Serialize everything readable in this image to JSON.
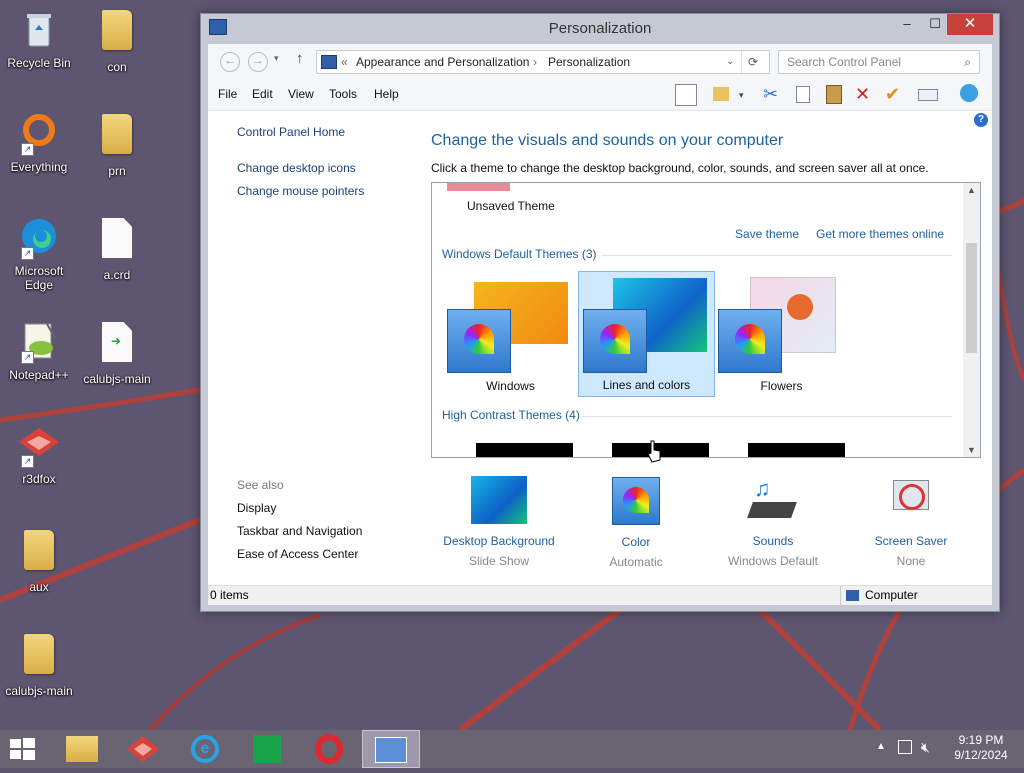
{
  "desktop": {
    "icons": [
      {
        "label": "Recycle Bin",
        "icon": "recycle-bin-icon"
      },
      {
        "label": "con",
        "icon": "folder-icon"
      },
      {
        "label": "Everything",
        "icon": "everything-icon"
      },
      {
        "label": "prn",
        "icon": "folder-icon"
      },
      {
        "label": "Microsoft Edge",
        "icon": "edge-icon"
      },
      {
        "label": "a.crd",
        "icon": "file-icon"
      },
      {
        "label": "Notepad++",
        "icon": "notepadpp-icon"
      },
      {
        "label": "calubjs-main",
        "icon": "file-icon"
      },
      {
        "label": "r3dfox",
        "icon": "r3dfox-icon"
      },
      {
        "label": "aux",
        "icon": "folder-icon"
      },
      {
        "label": "calubjs-main",
        "icon": "folder-icon"
      }
    ]
  },
  "window": {
    "title": "Personalization",
    "close_symbol": "✕",
    "max_symbol": "☐",
    "min_symbol": "–",
    "address": {
      "prefix": "«",
      "crumb1": "Appearance and Personalization",
      "sep": "›",
      "crumb2": "Personalization"
    },
    "search_placeholder": "Search Control Panel",
    "menu": {
      "file": "File",
      "edit": "Edit",
      "view": "View",
      "tools": "Tools",
      "help": "Help"
    },
    "left": {
      "home": "Control Panel Home",
      "desktop_icons": "Change desktop icons",
      "mouse_pointers": "Change mouse pointers",
      "see_also": "See also",
      "display": "Display",
      "taskbar": "Taskbar and Navigation",
      "ease": "Ease of Access Center"
    },
    "main": {
      "title": "Change the visuals and sounds on your computer",
      "subtitle": "Click a theme to change the desktop background, color, sounds, and screen saver all at once.",
      "unsaved": "Unsaved Theme",
      "save_theme": "Save theme",
      "get_more": "Get more themes online",
      "default_section": "Windows Default Themes (3)",
      "themes": [
        "Windows",
        "Lines and colors",
        "Flowers"
      ],
      "contrast_section": "High Contrast Themes (4)"
    },
    "bottom": [
      {
        "title": "Desktop Background",
        "sub": "Slide Show"
      },
      {
        "title": "Color",
        "sub": "Automatic"
      },
      {
        "title": "Sounds",
        "sub": "Windows Default"
      },
      {
        "title": "Screen Saver",
        "sub": "None"
      }
    ],
    "status": {
      "items": "0 items",
      "location": "Computer"
    }
  },
  "taskbar": {
    "time": "9:19 PM",
    "date": "9/12/2024"
  }
}
